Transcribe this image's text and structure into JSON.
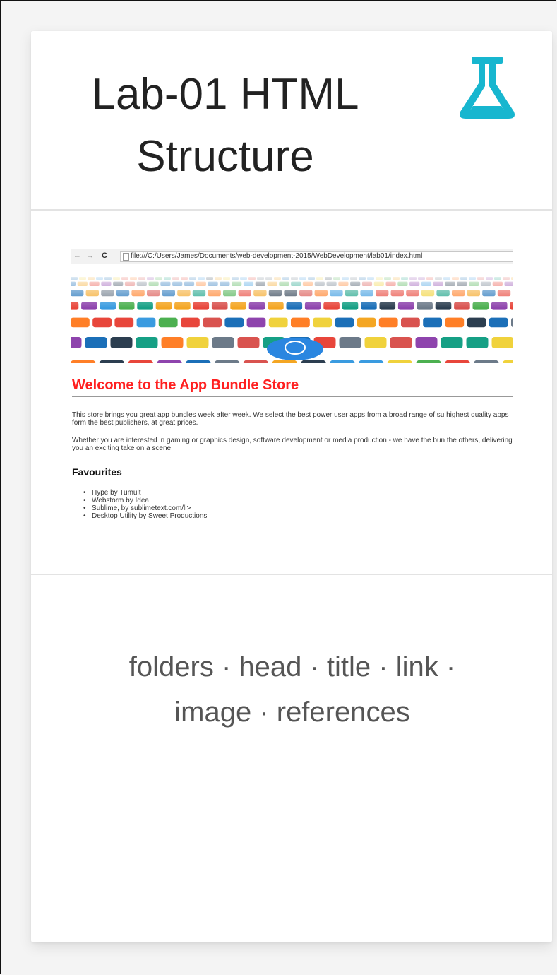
{
  "card": {
    "title": "Lab-01 HTML Structure",
    "icon": "flask-icon",
    "accent_color": "#17b6cf"
  },
  "screenshot": {
    "address_bar": "file:///C:/Users/James/Documents/web-development-2015/WebDevelopment/lab01/index.html",
    "nav_icons": [
      "back-arrow-icon",
      "forward-arrow-icon",
      "reload-icon"
    ],
    "heading": "Welcome to the App Bundle Store",
    "heading_color": "#ff2020",
    "paragraph_1": "This store brings you great app bundles week after week. We select the best power user apps from a broad range of su highest quality apps form the best publishers, at great prices.",
    "paragraph_2": "Whether you are interested in gaming or graphics design, software development or media production - we have the bun the others, delivering you an exciting take on a scene.",
    "favourites_heading": "Favourites",
    "favourites": [
      "Hype by Tumult",
      "Webstorm by Idea",
      "Sublime, by sublimetext.com/li>",
      "Desktop Utility by Sweet Productions"
    ]
  },
  "footer": {
    "keywords": "folders · head · title · link · image · references"
  }
}
